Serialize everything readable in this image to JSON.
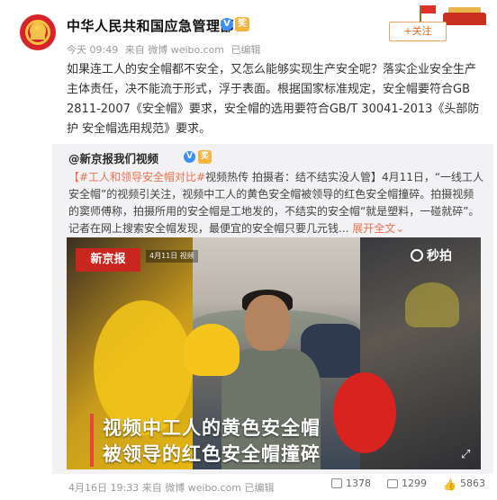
{
  "post": {
    "author": "中华人民共和国应急管理部",
    "verified_badge": "V",
    "medal_badge": "奖",
    "meta": {
      "time": "今天 09:49",
      "source": "来自 微博 weibo.com",
      "edited": "已编辑"
    },
    "follow_label": "+关注",
    "text": "如果连工人的安全帽都不安全，又怎么能够实现生产安全呢？落实企业安全生产主体责任，决不能流于形式，浮于表面。根据国家标准规定，安全帽要符合GB 2811-2007《安全帽》要求，安全帽的选用要符合GB/T 30041-2013《头部防护 安全帽选用规范》要求。"
  },
  "repost": {
    "author": "@新京报我们视频",
    "verified_badge": "V",
    "medal_badge": "奖",
    "topic": "【#工人和领导安全帽对比#",
    "text": "视频热传 拍摄者：结不结实没人管】4月11日，“一线工人安全帽”的视频引关注，视频中工人的黄色安全帽被领导的红色安全帽撞碎。拍摄视频的窦师傅称，拍摄所用的安全帽是工地发的，不结实的安全帽“就是塑料，一碰就碎”。记者在网上搜索安全帽发现，最便宜的安全帽只要几元钱... ",
    "expand_label": "展开全文",
    "expand_arrow": "⌄",
    "video": {
      "brand": "新京报",
      "date_tag": "4月11日 视频",
      "watermark": "秒拍",
      "caption_line1": "视频中工人的黄色安全帽",
      "caption_line2": "被领导的红色安全帽撞碎"
    },
    "footer": {
      "time": "4月16日 19:33",
      "source": "来自 微博 weibo.com",
      "edited": "已编辑"
    },
    "stats": {
      "shares": "1378",
      "comments": "1299",
      "likes": "5863"
    }
  },
  "colors": {
    "accent": "#eb7350",
    "verified": "#3e8ef7",
    "medal": "#f6b43c",
    "red_tag": "#c8261f"
  }
}
